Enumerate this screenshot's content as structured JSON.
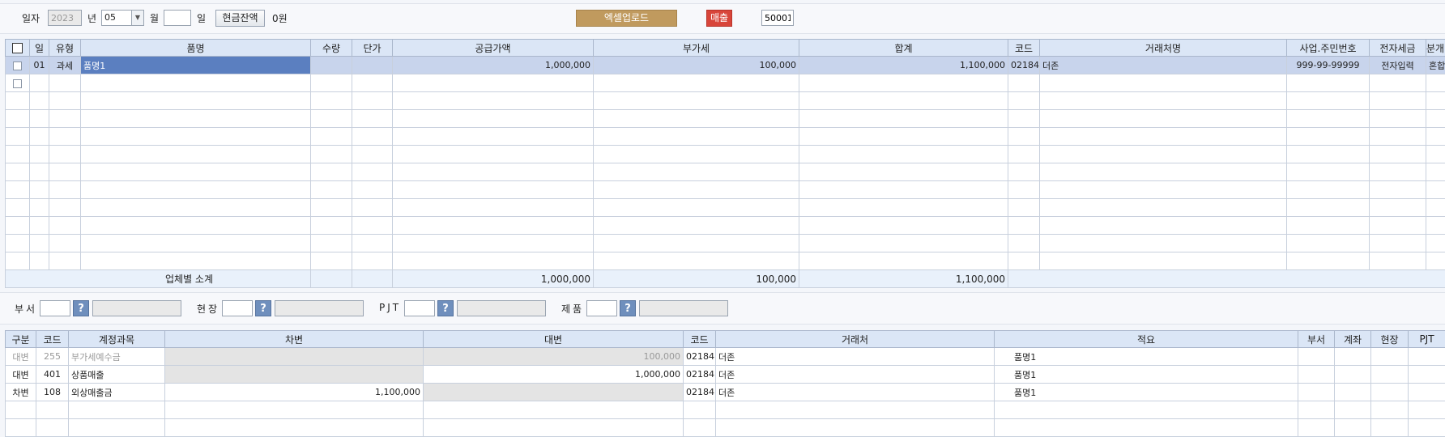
{
  "top": {
    "date_label": "일자",
    "year_value": "2023",
    "year_label": "년",
    "month_value": "05",
    "month_label": "월",
    "day_value": "",
    "day_label": "일",
    "cash_button": "현금잔액",
    "cash_value": "0원",
    "excel_button": "엑셀업로드",
    "sales_button": "매출",
    "code_value": "50001"
  },
  "grid": {
    "headers": [
      "일",
      "유형",
      "품명",
      "수량",
      "단가",
      "공급가액",
      "부가세",
      "합계",
      "코드",
      "거래처명",
      "사업.주민번호",
      "전자세금",
      "분개"
    ],
    "row1": {
      "day": "01",
      "type": "과세",
      "item": "품명1",
      "qty": "",
      "price": "",
      "supply": "1,000,000",
      "vat": "100,000",
      "total": "1,100,000",
      "code": "02184",
      "client": "더존",
      "bizno": "999-99-99999",
      "etax": "전자입력",
      "entry": "혼합"
    },
    "subtotal": {
      "label": "업체별 소계",
      "supply": "1,000,000",
      "vat": "100,000",
      "total": "1,100,000"
    }
  },
  "filters": {
    "dept_label": "부서",
    "site_label": "현장",
    "pjt_label": "PJT",
    "product_label": "제품",
    "q_icon": "?"
  },
  "journal": {
    "headers": [
      "구분",
      "코드",
      "계정과목",
      "차변",
      "대변",
      "코드",
      "거래처",
      "적요",
      "부서",
      "계좌",
      "현장",
      "PJT"
    ],
    "rows": [
      {
        "div": "대변",
        "code": "255",
        "account": "부가세예수금",
        "debit": "",
        "credit": "100,000",
        "ccode": "02184",
        "client": "더존",
        "memo": "품명1"
      },
      {
        "div": "대변",
        "code": "401",
        "account": "상품매출",
        "debit": "",
        "credit": "1,000,000",
        "ccode": "02184",
        "client": "더존",
        "memo": "품명1"
      },
      {
        "div": "차변",
        "code": "108",
        "account": "외상매출금",
        "debit": "1,100,000",
        "credit": "",
        "ccode": "02184",
        "client": "더존",
        "memo": "품명1"
      }
    ]
  }
}
